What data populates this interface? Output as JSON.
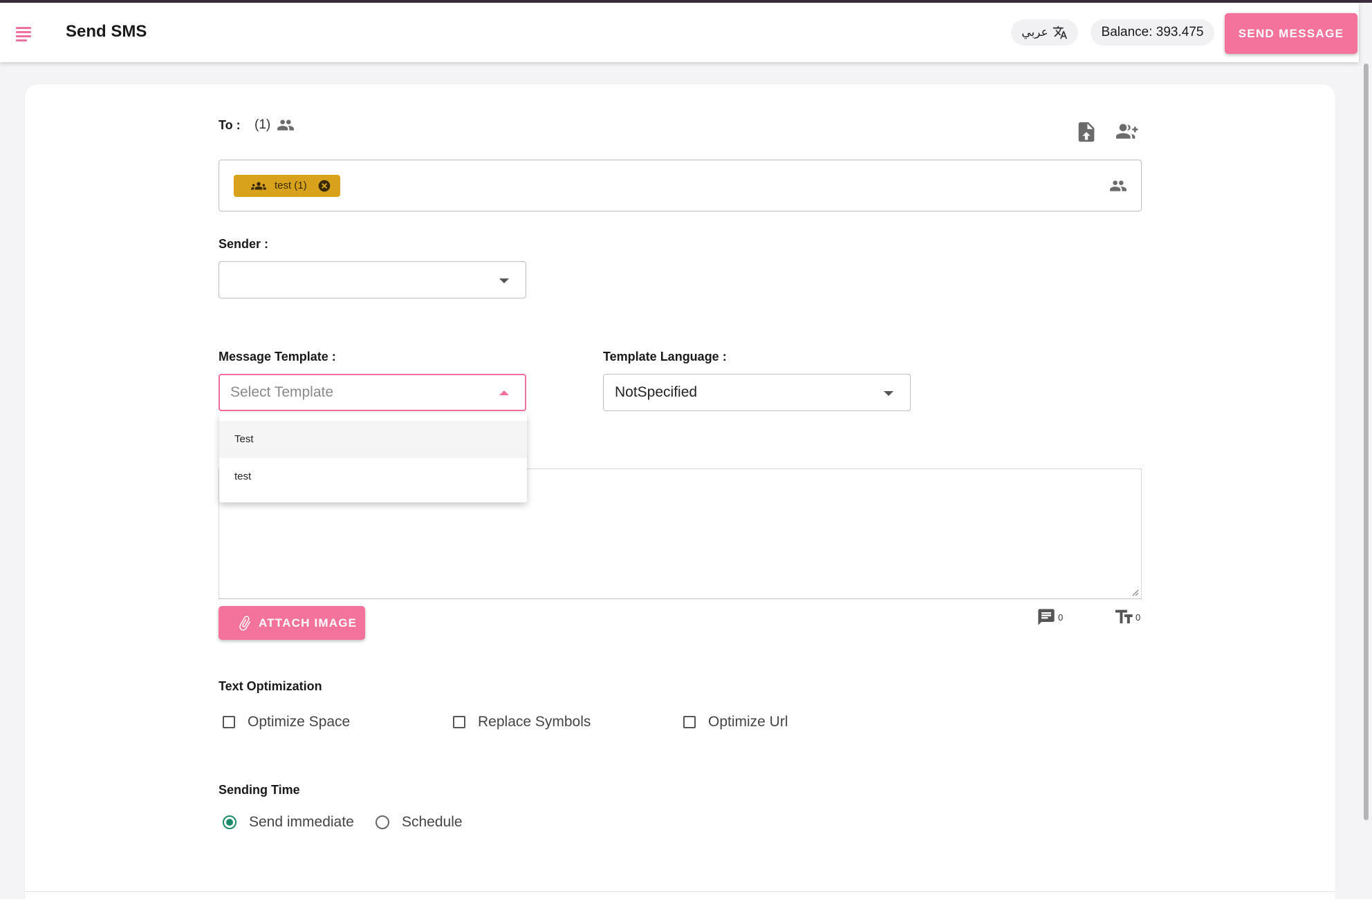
{
  "header": {
    "title": "Send SMS",
    "language_label": "عربي",
    "balance_text": "Balance: 393.475",
    "send_message_label": "SEND MESSAGE"
  },
  "to": {
    "label": "To :",
    "count": "(1)",
    "chip_label": "test (1)"
  },
  "sender": {
    "label": "Sender :",
    "value": ""
  },
  "message_template": {
    "label": "Message Template :",
    "placeholder": "Select Template",
    "options": [
      "Test",
      "test"
    ],
    "open": true
  },
  "template_language": {
    "label": "Template Language :",
    "value": "NotSpecified"
  },
  "message": {
    "attach_label": "ATTACH IMAGE",
    "message_count": "0",
    "char_count": "0"
  },
  "text_optimization": {
    "label": "Text Optimization",
    "options": [
      "Optimize Space",
      "Replace Symbols",
      "Optimize Url"
    ]
  },
  "sending_time": {
    "label": "Sending Time",
    "options": [
      "Send immediate",
      "Schedule"
    ],
    "selected": "Send immediate"
  },
  "colors": {
    "accent": "#f4739d",
    "chip": "#d9a21c",
    "radio_selected": "#1b8a6b"
  }
}
